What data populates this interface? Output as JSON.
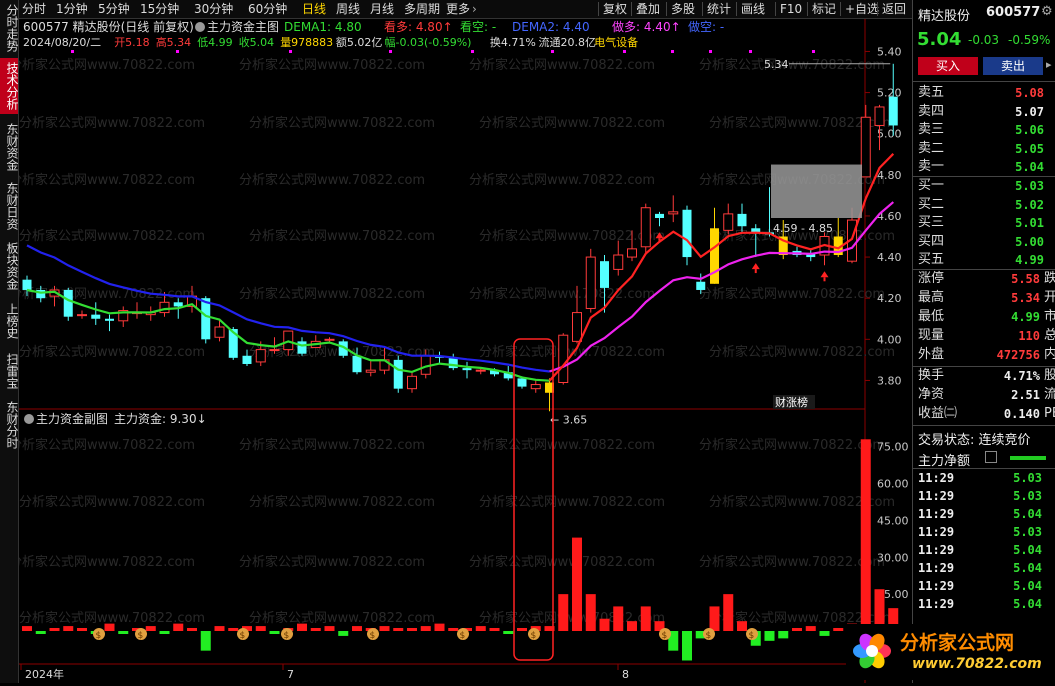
{
  "toolbar": {
    "window_icon": "window-icon",
    "periods": [
      "分时",
      "1分钟",
      "5分钟",
      "15分钟",
      "30分钟",
      "60分钟",
      "日线",
      "周线",
      "月线",
      "多周期",
      "更多"
    ],
    "active_period": "日线",
    "more_chevron": "chevron-right-icon",
    "right_buttons": [
      "复权",
      "叠加",
      "多股",
      "统计",
      "画线",
      "F10",
      "标记",
      "+自选",
      "返回"
    ]
  },
  "left_tabs": [
    "分时走势",
    "技术分析",
    "东财资金",
    "东财日资",
    "板块资金",
    "上榜史",
    "扫雷宝",
    "东财分时"
  ],
  "active_left_tab": "技术分析",
  "main_chart": {
    "stock_info": "600577 精达股份(日线 前复权)",
    "indicator_name": "主力资金主图",
    "legend": [
      {
        "text": "DEMA1: 4.80",
        "color": "#33dd33"
      },
      {
        "text": "看多: 4.80",
        "color": "#ff3b3b"
      },
      {
        "text": "看空: -",
        "color": "#33dd33"
      },
      {
        "text": "DEMA2: 4.40",
        "color": "#4466ff"
      },
      {
        "text": "做多: 4.40",
        "color": "#ff44ff"
      },
      {
        "text": "做空: -",
        "color": "#4466ff"
      }
    ],
    "quote_line": [
      {
        "text": "2024/08/20/二",
        "color": "#dddddd"
      },
      {
        "text": "开5.18",
        "color": "#ff3b3b"
      },
      {
        "text": "高5.34",
        "color": "#ff3b3b"
      },
      {
        "text": "低4.99",
        "color": "#33dd33"
      },
      {
        "text": "收5.04",
        "color": "#33dd33"
      },
      {
        "text": "量978883",
        "color": "#ffd700"
      },
      {
        "text": "额5.02亿",
        "color": "#dddddd"
      },
      {
        "text": "幅-0.03(-0.59%)",
        "color": "#33dd33"
      },
      {
        "text": "换4.71%",
        "color": "#dddddd"
      },
      {
        "text": "流通20.8亿",
        "color": "#dddddd"
      },
      {
        "text": "电气设备",
        "color": "#ffd700"
      }
    ],
    "watermark": "分析家公式网www.70822.com",
    "y_ticks": [
      "5.40",
      "5.20",
      "5.00",
      "4.80",
      "4.60",
      "4.40",
      "4.20",
      "4.00",
      "3.80"
    ],
    "y_range": [
      3.7,
      5.48
    ],
    "annotation_high": "5.34",
    "annotation_low": "3.65",
    "box_label": "4.59 - 4.85",
    "badge": "财涨榜"
  },
  "sub_chart": {
    "title": "主力资金副图",
    "value_label": "主力资金: 9.30",
    "y_ticks": [
      "75.00",
      "60.00",
      "45.00",
      "30.00",
      "15.00"
    ],
    "y_range": [
      0,
      83
    ],
    "x_labels": [
      "2024年",
      "7",
      "8"
    ]
  },
  "chart_data": {
    "type": "candlestick",
    "series_candles": [
      {
        "o": 4.29,
        "h": 4.31,
        "l": 4.21,
        "c": 4.24
      },
      {
        "o": 4.24,
        "h": 4.26,
        "l": 4.18,
        "c": 4.2
      },
      {
        "o": 4.21,
        "h": 4.26,
        "l": 4.16,
        "c": 4.24
      },
      {
        "o": 4.24,
        "h": 4.25,
        "l": 4.09,
        "c": 4.11
      },
      {
        "o": 4.12,
        "h": 4.14,
        "l": 4.1,
        "c": 4.12
      },
      {
        "o": 4.12,
        "h": 4.18,
        "l": 4.07,
        "c": 4.1
      },
      {
        "o": 4.1,
        "h": 4.12,
        "l": 4.04,
        "c": 4.09
      },
      {
        "o": 4.09,
        "h": 4.16,
        "l": 4.06,
        "c": 4.14
      },
      {
        "o": 4.13,
        "h": 4.18,
        "l": 4.1,
        "c": 4.13
      },
      {
        "o": 4.12,
        "h": 4.16,
        "l": 4.09,
        "c": 4.13
      },
      {
        "o": 4.13,
        "h": 4.23,
        "l": 4.11,
        "c": 4.18
      },
      {
        "o": 4.18,
        "h": 4.2,
        "l": 4.1,
        "c": 4.16
      },
      {
        "o": 4.16,
        "h": 4.26,
        "l": 4.13,
        "c": 4.21
      },
      {
        "o": 4.2,
        "h": 4.21,
        "l": 3.98,
        "c": 4.0
      },
      {
        "o": 4.01,
        "h": 4.1,
        "l": 3.99,
        "c": 4.06
      },
      {
        "o": 4.05,
        "h": 4.06,
        "l": 3.9,
        "c": 3.91
      },
      {
        "o": 3.92,
        "h": 3.95,
        "l": 3.87,
        "c": 3.88
      },
      {
        "o": 3.89,
        "h": 3.99,
        "l": 3.87,
        "c": 3.95
      },
      {
        "o": 3.95,
        "h": 4.01,
        "l": 3.93,
        "c": 3.95
      },
      {
        "o": 3.95,
        "h": 4.04,
        "l": 3.92,
        "c": 4.04
      },
      {
        "o": 3.99,
        "h": 4.01,
        "l": 3.92,
        "c": 3.93
      },
      {
        "o": 3.96,
        "h": 4.02,
        "l": 3.96,
        "c": 3.99
      },
      {
        "o": 4.0,
        "h": 4.01,
        "l": 3.98,
        "c": 4.0
      },
      {
        "o": 3.99,
        "h": 4.0,
        "l": 3.91,
        "c": 3.92
      },
      {
        "o": 3.92,
        "h": 3.96,
        "l": 3.83,
        "c": 3.84
      },
      {
        "o": 3.84,
        "h": 3.9,
        "l": 3.82,
        "c": 3.85
      },
      {
        "o": 3.85,
        "h": 3.96,
        "l": 3.83,
        "c": 3.9
      },
      {
        "o": 3.9,
        "h": 3.92,
        "l": 3.74,
        "c": 3.76
      },
      {
        "o": 3.76,
        "h": 3.84,
        "l": 3.74,
        "c": 3.82
      },
      {
        "o": 3.83,
        "h": 3.95,
        "l": 3.81,
        "c": 3.92
      },
      {
        "o": 3.92,
        "h": 3.94,
        "l": 3.88,
        "c": 3.91
      },
      {
        "o": 3.91,
        "h": 3.93,
        "l": 3.85,
        "c": 3.86
      },
      {
        "o": 3.86,
        "h": 3.89,
        "l": 3.81,
        "c": 3.85
      },
      {
        "o": 3.85,
        "h": 3.86,
        "l": 3.83,
        "c": 3.85
      },
      {
        "o": 3.85,
        "h": 3.86,
        "l": 3.82,
        "c": 3.83
      },
      {
        "o": 3.84,
        "h": 3.87,
        "l": 3.8,
        "c": 3.81
      },
      {
        "o": 3.81,
        "h": 3.82,
        "l": 3.76,
        "c": 3.77
      },
      {
        "o": 3.76,
        "h": 3.8,
        "l": 3.74,
        "c": 3.78
      },
      {
        "o": 3.74,
        "h": 3.81,
        "l": 3.65,
        "c": 3.79
      },
      {
        "o": 3.79,
        "h": 4.03,
        "l": 3.78,
        "c": 4.02
      },
      {
        "o": 3.99,
        "h": 4.26,
        "l": 3.98,
        "c": 4.13
      },
      {
        "o": 4.15,
        "h": 4.44,
        "l": 4.13,
        "c": 4.4
      },
      {
        "o": 4.38,
        "h": 4.41,
        "l": 4.13,
        "c": 4.25
      },
      {
        "o": 4.34,
        "h": 4.48,
        "l": 4.31,
        "c": 4.41
      },
      {
        "o": 4.4,
        "h": 4.53,
        "l": 4.38,
        "c": 4.44
      },
      {
        "o": 4.45,
        "h": 4.66,
        "l": 4.41,
        "c": 4.64
      },
      {
        "o": 4.61,
        "h": 4.62,
        "l": 4.55,
        "c": 4.59
      },
      {
        "o": 4.61,
        "h": 4.7,
        "l": 4.57,
        "c": 4.62
      },
      {
        "o": 4.63,
        "h": 4.65,
        "l": 4.36,
        "c": 4.4
      },
      {
        "o": 4.28,
        "h": 4.32,
        "l": 4.22,
        "c": 4.24
      },
      {
        "o": 4.27,
        "h": 4.64,
        "l": 4.27,
        "c": 4.54
      },
      {
        "o": 4.53,
        "h": 4.66,
        "l": 4.51,
        "c": 4.61
      },
      {
        "o": 4.61,
        "h": 4.66,
        "l": 4.52,
        "c": 4.55
      },
      {
        "o": 4.54,
        "h": 4.56,
        "l": 4.4,
        "c": 4.52
      },
      {
        "o": 4.52,
        "h": 4.74,
        "l": 4.5,
        "c": 4.51
      },
      {
        "o": 4.5,
        "h": 4.58,
        "l": 4.39,
        "c": 4.41
      },
      {
        "o": 4.43,
        "h": 4.45,
        "l": 4.4,
        "c": 4.41
      },
      {
        "o": 4.42,
        "h": 4.44,
        "l": 4.38,
        "c": 4.4
      },
      {
        "o": 4.41,
        "h": 4.52,
        "l": 4.36,
        "c": 4.5
      },
      {
        "o": 4.5,
        "h": 4.59,
        "l": 4.4,
        "c": 4.41
      },
      {
        "o": 4.38,
        "h": 4.64,
        "l": 4.37,
        "c": 4.58
      },
      {
        "o": 4.79,
        "h": 5.14,
        "l": 4.79,
        "c": 5.08
      },
      {
        "o": 5.04,
        "h": 5.14,
        "l": 4.92,
        "c": 5.13
      },
      {
        "o": 5.18,
        "h": 5.34,
        "l": 4.99,
        "c": 5.04
      }
    ],
    "dema1_start": 4.24,
    "dema2_start": 4.49,
    "money_flow": [
      2,
      -1,
      1,
      2,
      1,
      -1,
      3,
      -1,
      1,
      2,
      -1,
      3,
      1,
      -8,
      2,
      1,
      2,
      2,
      -1,
      1,
      3,
      1,
      2,
      -2,
      2,
      1,
      2,
      1,
      1,
      2,
      3,
      1,
      1,
      2,
      1,
      -1,
      1,
      2,
      2,
      15,
      38,
      15,
      5,
      10,
      4,
      10,
      4,
      -8,
      -12,
      -3,
      10,
      15,
      4,
      -6,
      -4,
      -3,
      1,
      2,
      -2,
      1,
      3,
      78,
      17,
      9.3
    ],
    "signal_markers": [
      6,
      10,
      16,
      20,
      25,
      31,
      42,
      51,
      53,
      62,
      66,
      70,
      75
    ],
    "up_arrows": [
      46,
      53,
      58
    ]
  },
  "right_panel": {
    "name": "精达股份",
    "code": "600577",
    "price": "5.04",
    "change": "-0.03",
    "change_pct": "-0.59%",
    "buy_btn": "买入",
    "sell_btn": "卖出",
    "asks": [
      {
        "label": "卖五",
        "price": "5.08",
        "color": "red"
      },
      {
        "label": "卖四",
        "price": "5.07",
        "color": "white"
      },
      {
        "label": "卖三",
        "price": "5.06",
        "color": "green"
      },
      {
        "label": "卖二",
        "price": "5.05",
        "color": "green"
      },
      {
        "label": "卖一",
        "price": "5.04",
        "color": "green"
      }
    ],
    "bids": [
      {
        "label": "买一",
        "price": "5.03",
        "color": "green"
      },
      {
        "label": "买二",
        "price": "5.02",
        "color": "green"
      },
      {
        "label": "买三",
        "price": "5.01",
        "color": "green"
      },
      {
        "label": "买四",
        "price": "5.00",
        "color": "green"
      },
      {
        "label": "买五",
        "price": "4.99",
        "color": "green"
      }
    ],
    "stats": [
      {
        "label": "涨停",
        "value": "5.58",
        "color": "red",
        "cut": "跌"
      },
      {
        "label": "最高",
        "value": "5.34",
        "color": "red",
        "cut": "开"
      },
      {
        "label": "最低",
        "value": "4.99",
        "color": "green",
        "cut": "市"
      },
      {
        "label": "现量",
        "value": "110",
        "color": "red",
        "cut": "总"
      },
      {
        "label": "外盘",
        "value": "472756",
        "color": "red",
        "cut": "内"
      }
    ],
    "stats2": [
      {
        "label": "换手",
        "value": "4.71%",
        "color": "white",
        "cut": "股"
      },
      {
        "label": "净资",
        "value": "2.51",
        "color": "white",
        "cut": "流"
      },
      {
        "label": "收益㈡",
        "value": "0.140",
        "color": "white",
        "cut": "PE"
      }
    ],
    "trade_status": "交易状态: 连续竞价",
    "net_inflow_label": "主力净额",
    "ticks": [
      {
        "time": "11:29",
        "price": "5.03"
      },
      {
        "time": "11:29",
        "price": "5.03"
      },
      {
        "time": "11:29",
        "price": "5.04"
      },
      {
        "time": "11:29",
        "price": "5.03"
      },
      {
        "time": "11:29",
        "price": "5.04"
      },
      {
        "time": "11:29",
        "price": "5.04"
      },
      {
        "time": "11:29",
        "price": "5.04"
      },
      {
        "time": "11:29",
        "price": "5.04"
      }
    ],
    "logo_text": "分析家公式网",
    "logo_url": "www.70822.com"
  }
}
